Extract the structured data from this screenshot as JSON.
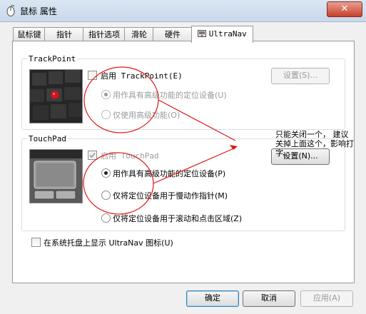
{
  "window": {
    "title": "鼠标 属性",
    "close_label": "✕"
  },
  "tabs": [
    {
      "label": "鼠标键"
    },
    {
      "label": "指针"
    },
    {
      "label": "指针选项"
    },
    {
      "label": "滑轮"
    },
    {
      "label": "硬件"
    },
    {
      "label": "UltraNav"
    }
  ],
  "active_tab": "UltraNav",
  "trackpoint": {
    "group_label": "TrackPoint",
    "enable_label": "启用 TrackPoint(E)",
    "settings_button": "设置(S)...",
    "option_advanced": "用作具有高级功能的定位设备(U)",
    "option_advanced_only": "仅使用高级功能(O)"
  },
  "touchpad": {
    "group_label": "TouchPad",
    "enable_label": "启用 TouchPad",
    "settings_button": "设置(N)...",
    "option_advanced": "用作具有高级功能的定位设备(P)",
    "option_slow_pointer": "仅将定位设备用于慢动作指针(M)",
    "option_scroll_click": "仅将定位设备用于滚动和点击区域(Z)"
  },
  "tray_label": "在系统托盘上显示 UltraNav 图标(U)",
  "buttons": {
    "ok": "确定",
    "cancel": "取消",
    "apply": "应用(A)"
  },
  "annotation": {
    "line1": "只能关闭一个， 建议",
    "line2": "关掉上面这个，影响打",
    "line3": "字。"
  },
  "colors": {
    "annotation_red": "#e01818",
    "tab_border": "#999999",
    "default_button": "#3c7fb1"
  }
}
